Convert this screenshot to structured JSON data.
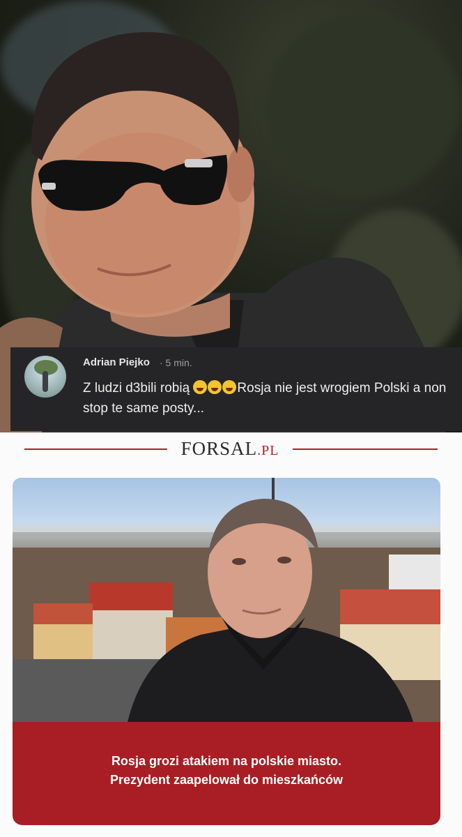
{
  "comment": {
    "author": "Adrian Piejko",
    "time": "· 5 min.",
    "text_before": "Z ludzi d3bili robią ",
    "emoji_name": "rofl-emoji",
    "emoji_count": 3,
    "text_after": "Rosja nie jest wrogiem Polski a non stop te same posty..."
  },
  "brand": {
    "name_main": "FORSAL",
    "name_suffix": ".PL",
    "accent_color": "#b31e22"
  },
  "article": {
    "headline_line1": "Rosja grozi atakiem na polskie miasto.",
    "headline_line2": "Prezydent zaapelował do mieszkańców",
    "caption_bg": "#a81e24"
  },
  "icons": [
    "avatar",
    "rofl-emoji"
  ]
}
